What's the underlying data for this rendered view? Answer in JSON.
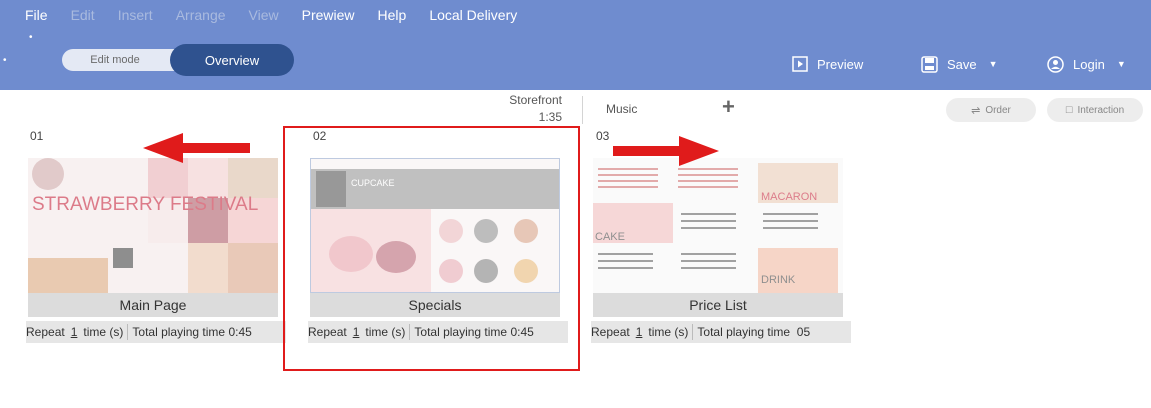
{
  "menu": {
    "items": [
      {
        "label": "File",
        "enabled": true
      },
      {
        "label": "Edit",
        "enabled": false
      },
      {
        "label": "Insert",
        "enabled": false
      },
      {
        "label": "Arrange",
        "enabled": false
      },
      {
        "label": "View",
        "enabled": false
      },
      {
        "label": "Prewiew",
        "enabled": true
      },
      {
        "label": "Help",
        "enabled": true
      },
      {
        "label": "Local Delivery",
        "enabled": true
      }
    ]
  },
  "mode": {
    "edit_label": "Edit mode",
    "overview_label": "Overview",
    "active": "Overview"
  },
  "toolbar": {
    "preview_label": "Preview",
    "save_label": "Save",
    "login_label": "Login"
  },
  "timeline": {
    "storefront_label": "Storefront",
    "storefront_time": "1:35",
    "music_label": "Music",
    "order_label": "Order",
    "interaction_label": "Interaction"
  },
  "slides": [
    {
      "number": "01",
      "name": "Main Page",
      "repeat_prefix": "Repeat",
      "repeat_count": "1",
      "repeat_suffix": "time (s)",
      "total_label": "Total playing time 0:45",
      "thumb_title": "STRAWBERRY FESTIVAL"
    },
    {
      "number": "02",
      "name": "Specials",
      "repeat_prefix": "Repeat",
      "repeat_count": "1",
      "repeat_suffix": "time (s)",
      "total_label": "Total playing time 0:45",
      "thumb_title": "CUPCAKE"
    },
    {
      "number": "03",
      "name": "Price List",
      "repeat_prefix": "Repeat",
      "repeat_count": "1",
      "repeat_suffix": "time (s)",
      "total_label": "Total playing time  05",
      "thumb_title": "MACARON",
      "thumb_cake": "CAKE",
      "thumb_drink": "DRINK"
    }
  ],
  "colors": {
    "topbar": "#6f8ccf",
    "overview_pill": "#2f528f",
    "highlight": "#e01b1b",
    "arrow": "#e01b1b"
  }
}
